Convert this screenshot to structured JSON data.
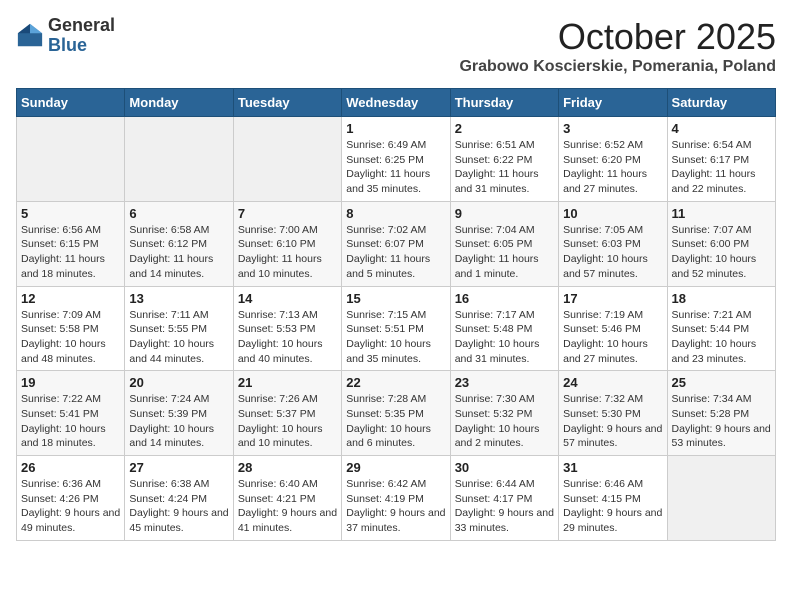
{
  "logo": {
    "general": "General",
    "blue": "Blue"
  },
  "title": {
    "month": "October 2025",
    "location": "Grabowo Koscierskie, Pomerania, Poland"
  },
  "headers": [
    "Sunday",
    "Monday",
    "Tuesday",
    "Wednesday",
    "Thursday",
    "Friday",
    "Saturday"
  ],
  "weeks": [
    [
      {
        "day": "",
        "sunrise": "",
        "sunset": "",
        "daylight": "",
        "empty": true
      },
      {
        "day": "",
        "sunrise": "",
        "sunset": "",
        "daylight": "",
        "empty": true
      },
      {
        "day": "",
        "sunrise": "",
        "sunset": "",
        "daylight": "",
        "empty": true
      },
      {
        "day": "1",
        "sunrise": "Sunrise: 6:49 AM",
        "sunset": "Sunset: 6:25 PM",
        "daylight": "Daylight: 11 hours and 35 minutes."
      },
      {
        "day": "2",
        "sunrise": "Sunrise: 6:51 AM",
        "sunset": "Sunset: 6:22 PM",
        "daylight": "Daylight: 11 hours and 31 minutes."
      },
      {
        "day": "3",
        "sunrise": "Sunrise: 6:52 AM",
        "sunset": "Sunset: 6:20 PM",
        "daylight": "Daylight: 11 hours and 27 minutes."
      },
      {
        "day": "4",
        "sunrise": "Sunrise: 6:54 AM",
        "sunset": "Sunset: 6:17 PM",
        "daylight": "Daylight: 11 hours and 22 minutes."
      }
    ],
    [
      {
        "day": "5",
        "sunrise": "Sunrise: 6:56 AM",
        "sunset": "Sunset: 6:15 PM",
        "daylight": "Daylight: 11 hours and 18 minutes."
      },
      {
        "day": "6",
        "sunrise": "Sunrise: 6:58 AM",
        "sunset": "Sunset: 6:12 PM",
        "daylight": "Daylight: 11 hours and 14 minutes."
      },
      {
        "day": "7",
        "sunrise": "Sunrise: 7:00 AM",
        "sunset": "Sunset: 6:10 PM",
        "daylight": "Daylight: 11 hours and 10 minutes."
      },
      {
        "day": "8",
        "sunrise": "Sunrise: 7:02 AM",
        "sunset": "Sunset: 6:07 PM",
        "daylight": "Daylight: 11 hours and 5 minutes."
      },
      {
        "day": "9",
        "sunrise": "Sunrise: 7:04 AM",
        "sunset": "Sunset: 6:05 PM",
        "daylight": "Daylight: 11 hours and 1 minute."
      },
      {
        "day": "10",
        "sunrise": "Sunrise: 7:05 AM",
        "sunset": "Sunset: 6:03 PM",
        "daylight": "Daylight: 10 hours and 57 minutes."
      },
      {
        "day": "11",
        "sunrise": "Sunrise: 7:07 AM",
        "sunset": "Sunset: 6:00 PM",
        "daylight": "Daylight: 10 hours and 52 minutes."
      }
    ],
    [
      {
        "day": "12",
        "sunrise": "Sunrise: 7:09 AM",
        "sunset": "Sunset: 5:58 PM",
        "daylight": "Daylight: 10 hours and 48 minutes."
      },
      {
        "day": "13",
        "sunrise": "Sunrise: 7:11 AM",
        "sunset": "Sunset: 5:55 PM",
        "daylight": "Daylight: 10 hours and 44 minutes."
      },
      {
        "day": "14",
        "sunrise": "Sunrise: 7:13 AM",
        "sunset": "Sunset: 5:53 PM",
        "daylight": "Daylight: 10 hours and 40 minutes."
      },
      {
        "day": "15",
        "sunrise": "Sunrise: 7:15 AM",
        "sunset": "Sunset: 5:51 PM",
        "daylight": "Daylight: 10 hours and 35 minutes."
      },
      {
        "day": "16",
        "sunrise": "Sunrise: 7:17 AM",
        "sunset": "Sunset: 5:48 PM",
        "daylight": "Daylight: 10 hours and 31 minutes."
      },
      {
        "day": "17",
        "sunrise": "Sunrise: 7:19 AM",
        "sunset": "Sunset: 5:46 PM",
        "daylight": "Daylight: 10 hours and 27 minutes."
      },
      {
        "day": "18",
        "sunrise": "Sunrise: 7:21 AM",
        "sunset": "Sunset: 5:44 PM",
        "daylight": "Daylight: 10 hours and 23 minutes."
      }
    ],
    [
      {
        "day": "19",
        "sunrise": "Sunrise: 7:22 AM",
        "sunset": "Sunset: 5:41 PM",
        "daylight": "Daylight: 10 hours and 18 minutes."
      },
      {
        "day": "20",
        "sunrise": "Sunrise: 7:24 AM",
        "sunset": "Sunset: 5:39 PM",
        "daylight": "Daylight: 10 hours and 14 minutes."
      },
      {
        "day": "21",
        "sunrise": "Sunrise: 7:26 AM",
        "sunset": "Sunset: 5:37 PM",
        "daylight": "Daylight: 10 hours and 10 minutes."
      },
      {
        "day": "22",
        "sunrise": "Sunrise: 7:28 AM",
        "sunset": "Sunset: 5:35 PM",
        "daylight": "Daylight: 10 hours and 6 minutes."
      },
      {
        "day": "23",
        "sunrise": "Sunrise: 7:30 AM",
        "sunset": "Sunset: 5:32 PM",
        "daylight": "Daylight: 10 hours and 2 minutes."
      },
      {
        "day": "24",
        "sunrise": "Sunrise: 7:32 AM",
        "sunset": "Sunset: 5:30 PM",
        "daylight": "Daylight: 9 hours and 57 minutes."
      },
      {
        "day": "25",
        "sunrise": "Sunrise: 7:34 AM",
        "sunset": "Sunset: 5:28 PM",
        "daylight": "Daylight: 9 hours and 53 minutes."
      }
    ],
    [
      {
        "day": "26",
        "sunrise": "Sunrise: 6:36 AM",
        "sunset": "Sunset: 4:26 PM",
        "daylight": "Daylight: 9 hours and 49 minutes."
      },
      {
        "day": "27",
        "sunrise": "Sunrise: 6:38 AM",
        "sunset": "Sunset: 4:24 PM",
        "daylight": "Daylight: 9 hours and 45 minutes."
      },
      {
        "day": "28",
        "sunrise": "Sunrise: 6:40 AM",
        "sunset": "Sunset: 4:21 PM",
        "daylight": "Daylight: 9 hours and 41 minutes."
      },
      {
        "day": "29",
        "sunrise": "Sunrise: 6:42 AM",
        "sunset": "Sunset: 4:19 PM",
        "daylight": "Daylight: 9 hours and 37 minutes."
      },
      {
        "day": "30",
        "sunrise": "Sunrise: 6:44 AM",
        "sunset": "Sunset: 4:17 PM",
        "daylight": "Daylight: 9 hours and 33 minutes."
      },
      {
        "day": "31",
        "sunrise": "Sunrise: 6:46 AM",
        "sunset": "Sunset: 4:15 PM",
        "daylight": "Daylight: 9 hours and 29 minutes."
      },
      {
        "day": "",
        "sunrise": "",
        "sunset": "",
        "daylight": "",
        "empty": true
      }
    ]
  ]
}
